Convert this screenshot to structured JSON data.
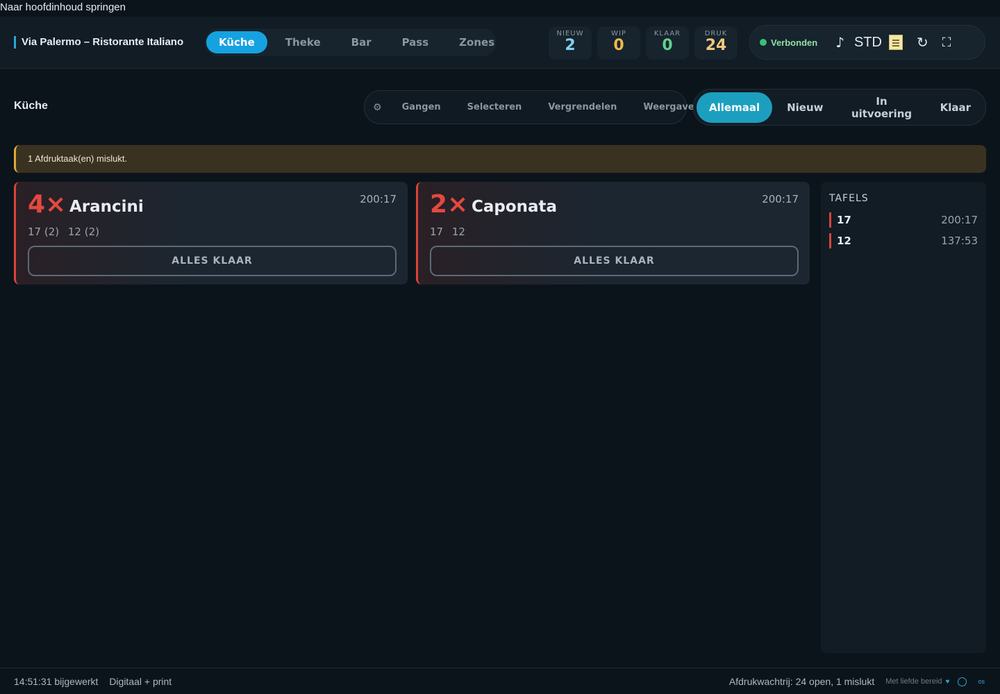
{
  "skip_link": "Naar hoofdinhoud springen",
  "header": {
    "brand": "Via Palermo – Ristorante Italiano",
    "stations": [
      {
        "label": "Küche",
        "active": true
      },
      {
        "label": "Theke",
        "active": false
      },
      {
        "label": "Bar",
        "active": false
      },
      {
        "label": "Pass",
        "active": false
      },
      {
        "label": "Zones",
        "active": false
      }
    ],
    "counters": [
      {
        "label": "NIEUW",
        "value": "2",
        "color": "#7fd3f0"
      },
      {
        "label": "WIP",
        "value": "0",
        "color": "#f0b84a"
      },
      {
        "label": "KLAAR",
        "value": "0",
        "color": "#5fd08f"
      },
      {
        "label": "DRUK",
        "value": "24",
        "color": "#f2c77a"
      }
    ],
    "connection": {
      "label": "Verbonden",
      "color": "#38c172"
    },
    "sound_icon": "♪",
    "mode_label": "STD",
    "refresh_icon": "↻",
    "fullscreen_icon": "⛶"
  },
  "page_title": "Küche",
  "tools": {
    "gear_icon": "⚙",
    "items": [
      "Gangen",
      "Selecteren",
      "Vergrendelen",
      "Weergave"
    ]
  },
  "filters": [
    {
      "label": "Allemaal",
      "active": true
    },
    {
      "label": "Nieuw",
      "active": false
    },
    {
      "label": "In uitvoering",
      "active": false
    },
    {
      "label": "Klaar",
      "active": false
    }
  ],
  "alert": "1 Afdruktaak(en) mislukt.",
  "cards": [
    {
      "qty": "4×",
      "name": "Arancini",
      "time": "200:17",
      "tables": [
        "17 (2)",
        "12 (2)"
      ],
      "action": "ALLES KLAAR"
    },
    {
      "qty": "2×",
      "name": "Caponata",
      "time": "200:17",
      "tables": [
        "17",
        "12"
      ],
      "action": "ALLES KLAAR"
    }
  ],
  "sidebar": {
    "title": "TAFELS",
    "rows": [
      {
        "id": "17",
        "time": "200:17"
      },
      {
        "id": "12",
        "time": "137:53"
      }
    ]
  },
  "footer": {
    "updated": "14:51:31 bijgewerkt",
    "mode": "Digitaal + print",
    "print_queue": "Afdrukwachtrij: 24 open, 1 mislukt",
    "credit": "Met liefde bereid",
    "heart_icon": "♥",
    "os_tag": "os"
  }
}
